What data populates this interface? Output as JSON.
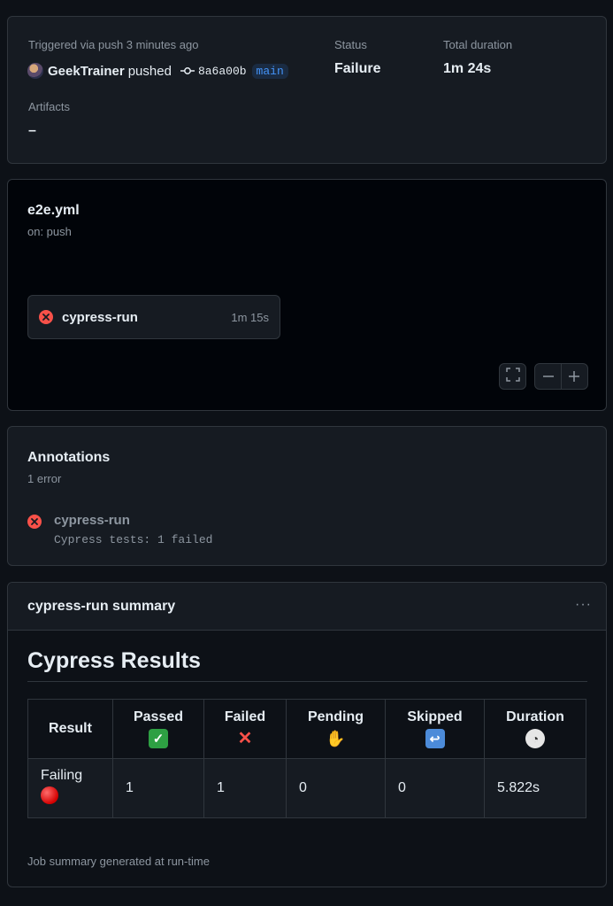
{
  "run": {
    "triggered_text": "Triggered via push 3 minutes ago",
    "user": "GeekTrainer",
    "action": "pushed",
    "commit_sha": "8a6a00b",
    "branch": "main",
    "status_label": "Status",
    "status_value": "Failure",
    "duration_label": "Total duration",
    "duration_value": "1m 24s",
    "artifacts_label": "Artifacts",
    "artifacts_value": "–"
  },
  "workflow": {
    "file": "e2e.yml",
    "trigger": "on: push",
    "job": {
      "name": "cypress-run",
      "duration": "1m 15s",
      "status": "failure"
    },
    "icons": {
      "fullscreen": "fullscreen-icon",
      "zoom_out": "minus-icon",
      "zoom_in": "plus-icon"
    }
  },
  "annotations": {
    "title": "Annotations",
    "count": "1 error",
    "items": [
      {
        "job": "cypress-run",
        "message": "Cypress tests: 1 failed"
      }
    ]
  },
  "job_summary": {
    "title": "cypress-run summary",
    "heading": "Cypress Results",
    "columns": [
      "Result",
      "Passed",
      "Failed",
      "Pending",
      "Skipped",
      "Duration"
    ],
    "column_icons": [
      "",
      "check-emoji",
      "cross-emoji",
      "hand-emoji",
      "undo-emoji",
      "clock-emoji"
    ],
    "row": {
      "result": "Failing",
      "passed": "1",
      "failed": "1",
      "pending": "0",
      "skipped": "0",
      "duration": "5.822s"
    },
    "footer": "Job summary generated at run-time"
  },
  "colors": {
    "background": "#0d1117",
    "card": "#161b22",
    "border": "#30363d",
    "failure": "#f85149",
    "link": "#4493f8"
  }
}
